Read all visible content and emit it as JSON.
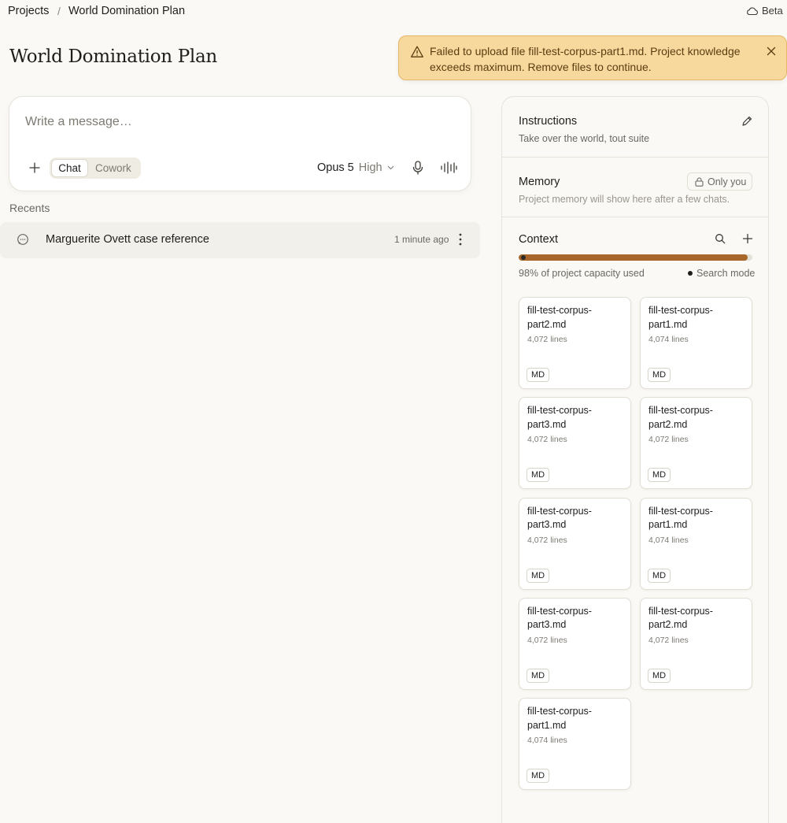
{
  "breadcrumb": {
    "root": "Projects",
    "separator": "/",
    "current": "World Domination Plan"
  },
  "header": {
    "beta_label": "Beta",
    "beta_icon": "cloud-icon"
  },
  "page": {
    "title": "World Domination Plan"
  },
  "toast": {
    "icon": "warning-triangle-icon",
    "message": "Failed to upload file fill-test-corpus-part1.md. Project knowledge exceeds maximum. Remove files to continue.",
    "close_icon": "close-icon",
    "colors": {
      "background": "#f7d99e",
      "border": "#e4b867",
      "text": "#5a3d10"
    }
  },
  "composer": {
    "placeholder": "Write a message…",
    "modes": [
      "Chat",
      "Cowork"
    ],
    "active_mode": "Chat",
    "model": "Opus 5",
    "effort": "High"
  },
  "recents": {
    "label": "Recents",
    "items": [
      {
        "title": "Marguerite Ovett case reference",
        "time": "1 minute ago",
        "icon": "chat-bubble-icon"
      }
    ]
  },
  "instructions": {
    "title": "Instructions",
    "text": "Take over the world, tout suite"
  },
  "memory": {
    "title": "Memory",
    "badge": "Only you",
    "text": "Project memory will show here after a few chats."
  },
  "context": {
    "title": "Context",
    "capacity_percent": 98,
    "capacity_text": "98% of project capacity used",
    "search_mode": "Search mode",
    "accent_color": "#a8672a",
    "files": [
      {
        "name": "fill-test-corpus-part2.md",
        "lines": "4,072 lines",
        "type": "MD"
      },
      {
        "name": "fill-test-corpus-part1.md",
        "lines": "4,074 lines",
        "type": "MD"
      },
      {
        "name": "fill-test-corpus-part3.md",
        "lines": "4,072 lines",
        "type": "MD"
      },
      {
        "name": "fill-test-corpus-part2.md",
        "lines": "4,072 lines",
        "type": "MD"
      },
      {
        "name": "fill-test-corpus-part3.md",
        "lines": "4,072 lines",
        "type": "MD"
      },
      {
        "name": "fill-test-corpus-part1.md",
        "lines": "4,074 lines",
        "type": "MD"
      },
      {
        "name": "fill-test-corpus-part3.md",
        "lines": "4,072 lines",
        "type": "MD"
      },
      {
        "name": "fill-test-corpus-part2.md",
        "lines": "4,072 lines",
        "type": "MD"
      },
      {
        "name": "fill-test-corpus-part1.md",
        "lines": "4,074 lines",
        "type": "MD"
      }
    ]
  }
}
